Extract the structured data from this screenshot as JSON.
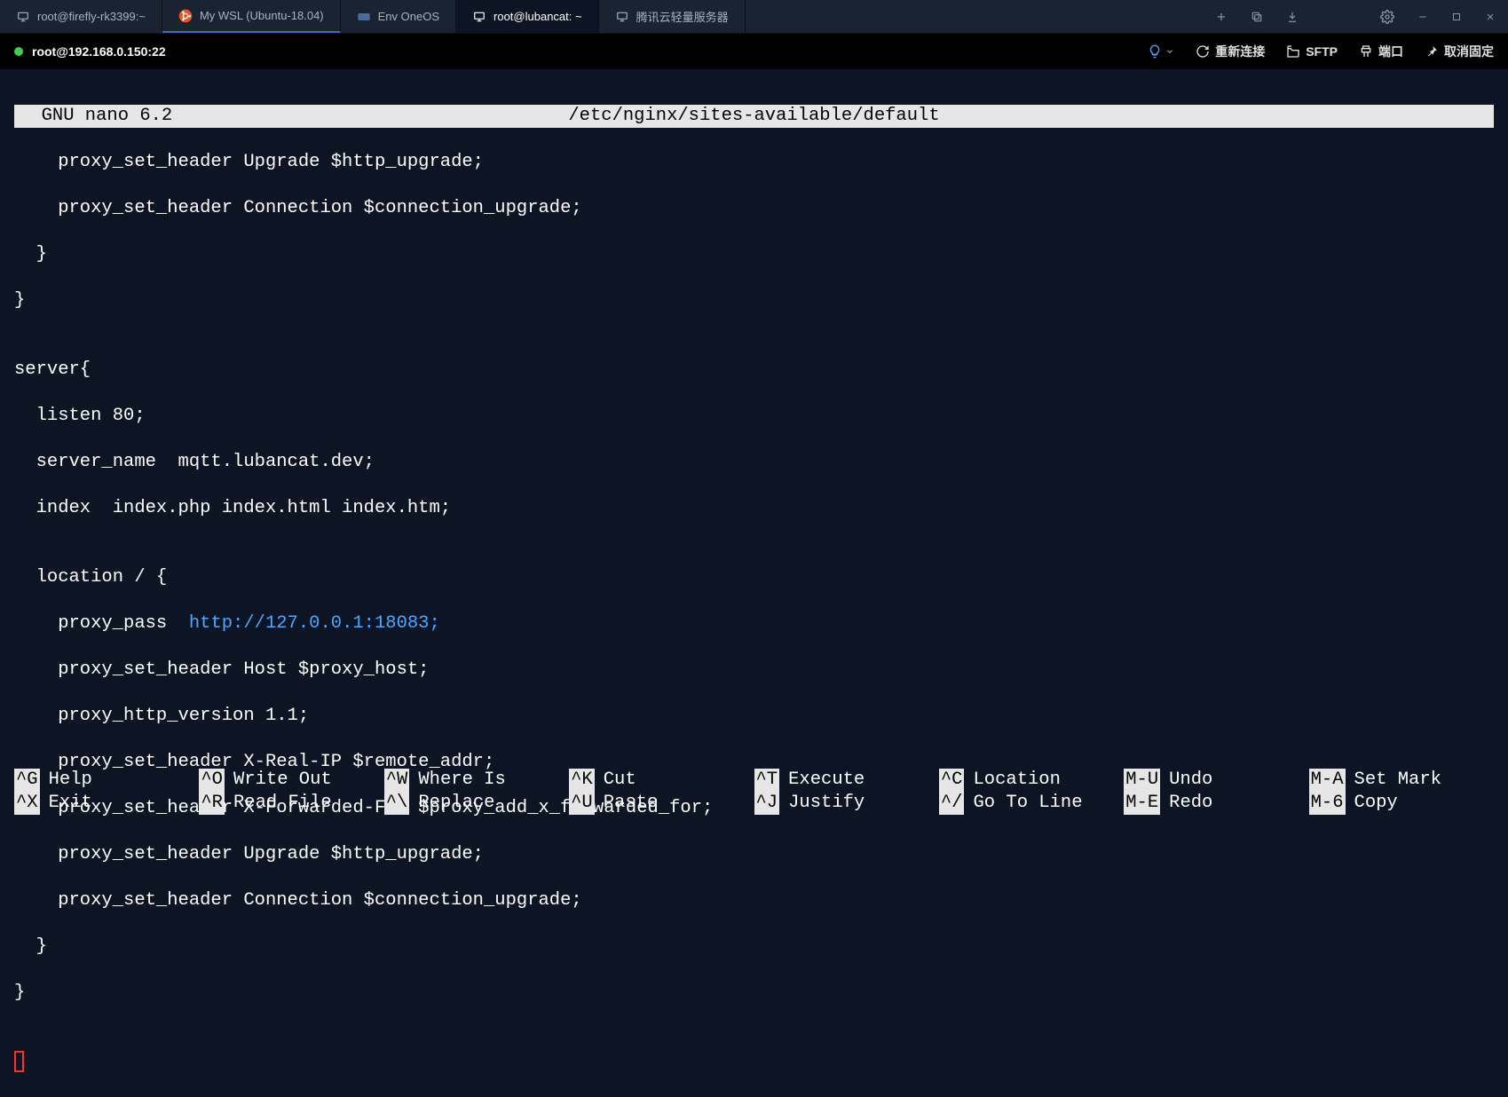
{
  "tabs": [
    {
      "label": "root@firefly-rk3399:~",
      "icon": "monitor"
    },
    {
      "label": "My WSL (Ubuntu-18.04)",
      "icon": "ubuntu"
    },
    {
      "label": "Env OneOS",
      "icon": "oneos"
    },
    {
      "label": "root@lubancat: ~",
      "icon": "monitor",
      "active": true
    },
    {
      "label": "腾讯云轻量服务器",
      "icon": "monitor"
    }
  ],
  "session": {
    "title": "root@192.168.0.150:22",
    "actions": {
      "reconnect": "重新连接",
      "sftp": "SFTP",
      "port": "端口",
      "unpin": "取消固定"
    }
  },
  "nano": {
    "banner_left": "  GNU nano 6.2",
    "banner_center": "/etc/nginx/sites-available/default",
    "lines": [
      "    proxy_set_header Upgrade $http_upgrade;",
      "    proxy_set_header Connection $connection_upgrade;",
      "  }",
      "}",
      "",
      "server{",
      "  listen 80;",
      "  server_name  mqtt.lubancat.dev;",
      "  index  index.php index.html index.htm;",
      "",
      "  location / {"
    ],
    "proxy_pass_prefix": "    proxy_pass  ",
    "proxy_pass_url": "http://127.0.0.1:18083;",
    "lines_after": [
      "    proxy_set_header Host $proxy_host;",
      "    proxy_http_version 1.1;",
      "    proxy_set_header X-Real-IP $remote_addr;",
      "    proxy_set_header X-Forwarded-For $proxy_add_x_forwarded_for;",
      "    proxy_set_header Upgrade $http_upgrade;",
      "    proxy_set_header Connection $connection_upgrade;",
      "  }",
      "}",
      ""
    ],
    "footer": {
      "row1": [
        {
          "key": "^G",
          "label": "Help"
        },
        {
          "key": "^O",
          "label": "Write Out"
        },
        {
          "key": "^W",
          "label": "Where Is"
        },
        {
          "key": "^K",
          "label": "Cut"
        },
        {
          "key": "^T",
          "label": "Execute"
        },
        {
          "key": "^C",
          "label": "Location"
        },
        {
          "key": "M-U",
          "label": "Undo"
        },
        {
          "key": "M-A",
          "label": "Set Mark"
        }
      ],
      "row2": [
        {
          "key": "^X",
          "label": "Exit"
        },
        {
          "key": "^R",
          "label": "Read File"
        },
        {
          "key": "^\\",
          "label": "Replace"
        },
        {
          "key": "^U",
          "label": "Paste"
        },
        {
          "key": "^J",
          "label": "Justify"
        },
        {
          "key": "^/",
          "label": "Go To Line"
        },
        {
          "key": "M-E",
          "label": "Redo"
        },
        {
          "key": "M-6",
          "label": "Copy"
        }
      ]
    }
  }
}
